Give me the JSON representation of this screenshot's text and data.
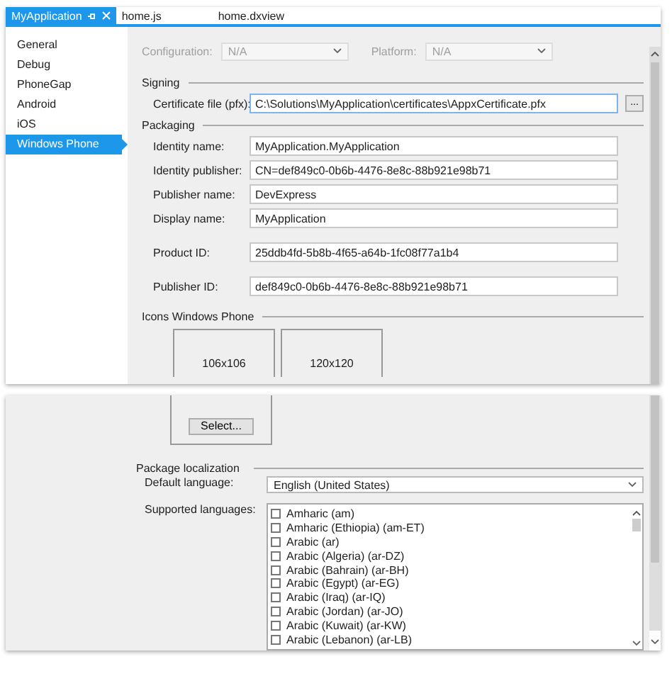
{
  "tabs": [
    {
      "label": "MyApplication",
      "selected": true
    },
    {
      "label": "home.js",
      "selected": false
    },
    {
      "label": "home.dxview",
      "selected": false
    }
  ],
  "sidebar": {
    "items": [
      {
        "label": "General",
        "selected": false
      },
      {
        "label": "Debug",
        "selected": false
      },
      {
        "label": "PhoneGap",
        "selected": false
      },
      {
        "label": "Android",
        "selected": false
      },
      {
        "label": "iOS",
        "selected": false
      },
      {
        "label": "Windows Phone",
        "selected": true
      }
    ]
  },
  "configuration": {
    "label": "Configuration:",
    "value": "N/A",
    "disabled": true
  },
  "platform": {
    "label": "Platform:",
    "value": "N/A",
    "disabled": true
  },
  "signing": {
    "title": "Signing",
    "certificate": {
      "label": "Certificate file (pfx):",
      "value": "C:\\Solutions\\MyApplication\\certificates\\AppxCertificate.pfx",
      "browse_button": "..."
    }
  },
  "packaging": {
    "title": "Packaging",
    "fields": [
      {
        "label": "Identity name:",
        "value": "MyApplication.MyApplication",
        "kind": "text"
      },
      {
        "label": "Identity publisher:",
        "value": "CN=def849c0-0b6b-4476-8e8c-88b921e98b71",
        "kind": "text"
      },
      {
        "label": "Publisher name:",
        "value": "DevExpress",
        "kind": "text"
      },
      {
        "label": "Display name:",
        "value": "MyApplication",
        "kind": "text"
      },
      {
        "label": "Product ID:",
        "value": "25ddb4fd-5b8b-4f65-a64b-1fc08f77a1b4",
        "kind": "id"
      },
      {
        "label": "Publisher ID:",
        "value": "def849c0-0b6b-4476-8e8c-88b921e98b71",
        "kind": "id"
      }
    ]
  },
  "icons": {
    "title": "Icons Windows Phone",
    "tiles": [
      {
        "label": "106x106"
      },
      {
        "label": "120x120"
      }
    ],
    "select_button": "Select..."
  },
  "localization": {
    "title": "Package localization",
    "default_language": {
      "label": "Default language:",
      "value": "English (United States)"
    },
    "supported_languages": {
      "label": "Supported languages:",
      "items": [
        {
          "label": "Amharic (am)",
          "checked": false
        },
        {
          "label": "Amharic (Ethiopia) (am-ET)",
          "checked": false
        },
        {
          "label": "Arabic (ar)",
          "checked": false
        },
        {
          "label": "Arabic (Algeria) (ar-DZ)",
          "checked": false
        },
        {
          "label": "Arabic (Bahrain) (ar-BH)",
          "checked": false
        },
        {
          "label": "Arabic (Egypt) (ar-EG)",
          "checked": false
        },
        {
          "label": "Arabic (Iraq) (ar-IQ)",
          "checked": false
        },
        {
          "label": "Arabic (Jordan) (ar-JO)",
          "checked": false
        },
        {
          "label": "Arabic (Kuwait) (ar-KW)",
          "checked": false
        },
        {
          "label": "Arabic (Lebanon) (ar-LB)",
          "checked": false
        }
      ]
    }
  }
}
